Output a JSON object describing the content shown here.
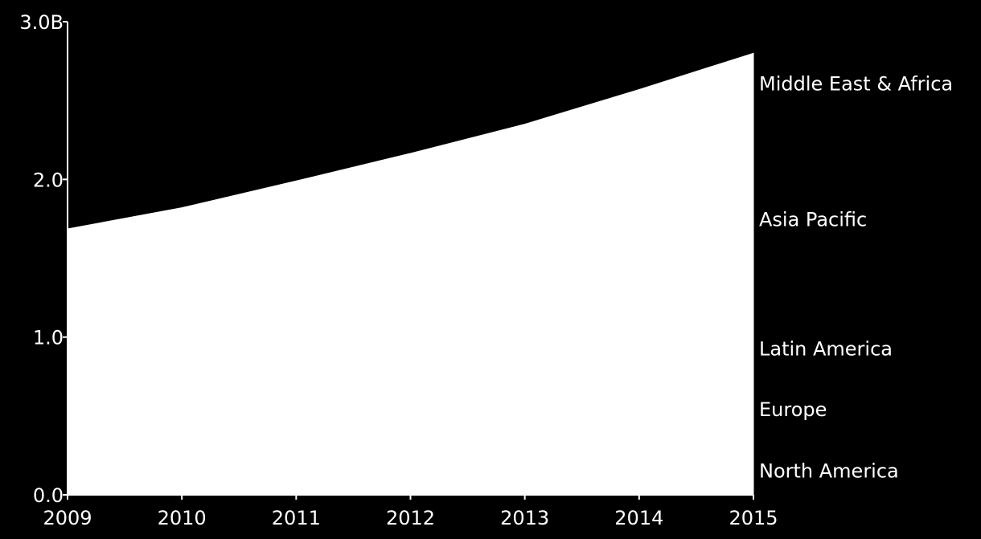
{
  "chart_data": {
    "type": "area",
    "stacked": true,
    "x": [
      2009,
      2010,
      2011,
      2012,
      2013,
      2014,
      2015
    ],
    "x_tick_labels": [
      "2009",
      "2010",
      "2011",
      "2012",
      "2013",
      "2014",
      "2015"
    ],
    "y_tick_values": [
      0,
      1,
      2,
      3
    ],
    "y_tick_labels": [
      "0.0",
      "1.0",
      "2.0",
      "3.0B"
    ],
    "ylim": [
      0,
      3
    ],
    "xlim": [
      2009,
      2015
    ],
    "unit": "B",
    "grid": false,
    "legend": "right, labels at series ends",
    "colors": {
      "background": "#000000",
      "fill": "#ffffff",
      "text": "#ffffff"
    },
    "series": [
      {
        "name": "North America",
        "values": [
          0.25,
          0.26,
          0.27,
          0.28,
          0.29,
          0.3,
          0.31
        ]
      },
      {
        "name": "Europe",
        "values": [
          0.42,
          0.43,
          0.44,
          0.45,
          0.46,
          0.465,
          0.47
        ]
      },
      {
        "name": "Latin America",
        "values": [
          0.2,
          0.21,
          0.23,
          0.25,
          0.27,
          0.285,
          0.3
        ]
      },
      {
        "name": "Asia Pacific",
        "values": [
          0.62,
          0.7,
          0.8,
          0.91,
          1.03,
          1.17,
          1.34
        ]
      },
      {
        "name": "Middle East & Africa",
        "values": [
          0.196,
          0.22,
          0.25,
          0.275,
          0.3,
          0.35,
          0.38
        ]
      }
    ]
  }
}
